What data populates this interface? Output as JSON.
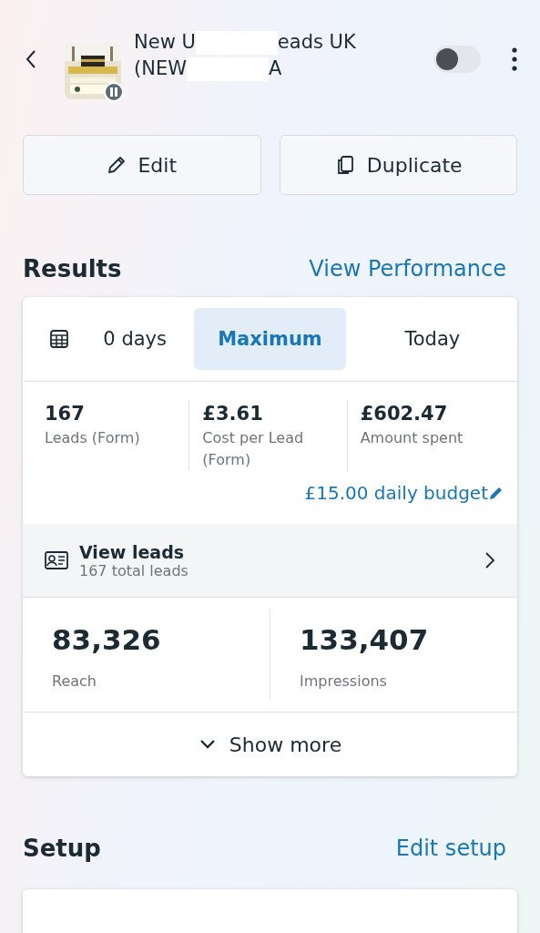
{
  "header": {
    "title_lines": [
      [
        "New U",
        "eads UK"
      ],
      [
        "(NEW",
        "A"
      ]
    ],
    "paused": true,
    "toggle": {
      "on": false
    }
  },
  "actions": [
    {
      "kind": "edit",
      "label": "Edit"
    },
    {
      "kind": "duplicate",
      "label": "Duplicate"
    }
  ],
  "results": {
    "title": "Results",
    "link": "View Performance",
    "date_tabs": [
      {
        "label": "0 days",
        "selected": false,
        "kind": "calendar"
      },
      {
        "label": "Maximum",
        "selected": true
      },
      {
        "label": "Today",
        "selected": false
      }
    ],
    "metrics": [
      {
        "value": "167",
        "label": "Leads (Form)"
      },
      {
        "value": "£3.61",
        "label": "Cost per Lead (Form)"
      },
      {
        "value": "£602.47",
        "label": "Amount spent"
      }
    ],
    "budget": "£15.00 daily budget",
    "leads": {
      "title": "View leads",
      "subtitle": "167 total leads"
    },
    "totals": [
      {
        "value": "83,326",
        "label": "Reach"
      },
      {
        "value": "133,407",
        "label": "Impressions"
      }
    ],
    "show_more": "Show more"
  },
  "setup": {
    "title": "Setup",
    "link": "Edit setup"
  }
}
